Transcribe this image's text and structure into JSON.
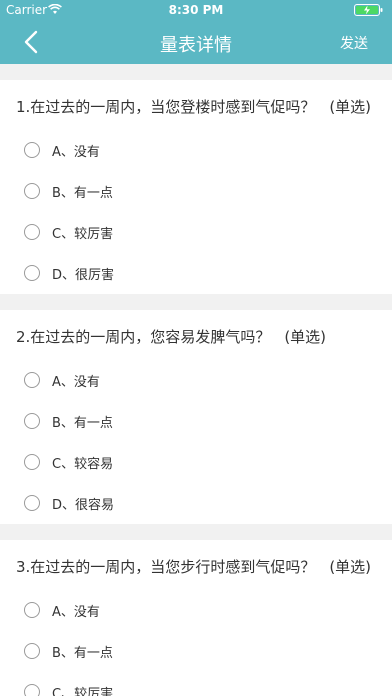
{
  "status": {
    "carrier": "Carrier",
    "time": "8:30 PM"
  },
  "nav": {
    "title": "量表详情",
    "send": "发送"
  },
  "questions": [
    {
      "title": "1.在过去的一周内，当您登楼时感到气促吗？",
      "type": "(单选)",
      "options": [
        "A、没有",
        "B、有一点",
        "C、较厉害",
        "D、很厉害"
      ]
    },
    {
      "title": "2.在过去的一周内，您容易发脾气吗？",
      "type": "(单选)",
      "options": [
        "A、没有",
        "B、有一点",
        "C、较容易",
        "D、很容易"
      ]
    },
    {
      "title": "3.在过去的一周内，当您步行时感到气促吗？",
      "type": "(单选)",
      "options": [
        "A、没有",
        "B、有一点",
        "C、较厉害"
      ]
    }
  ]
}
